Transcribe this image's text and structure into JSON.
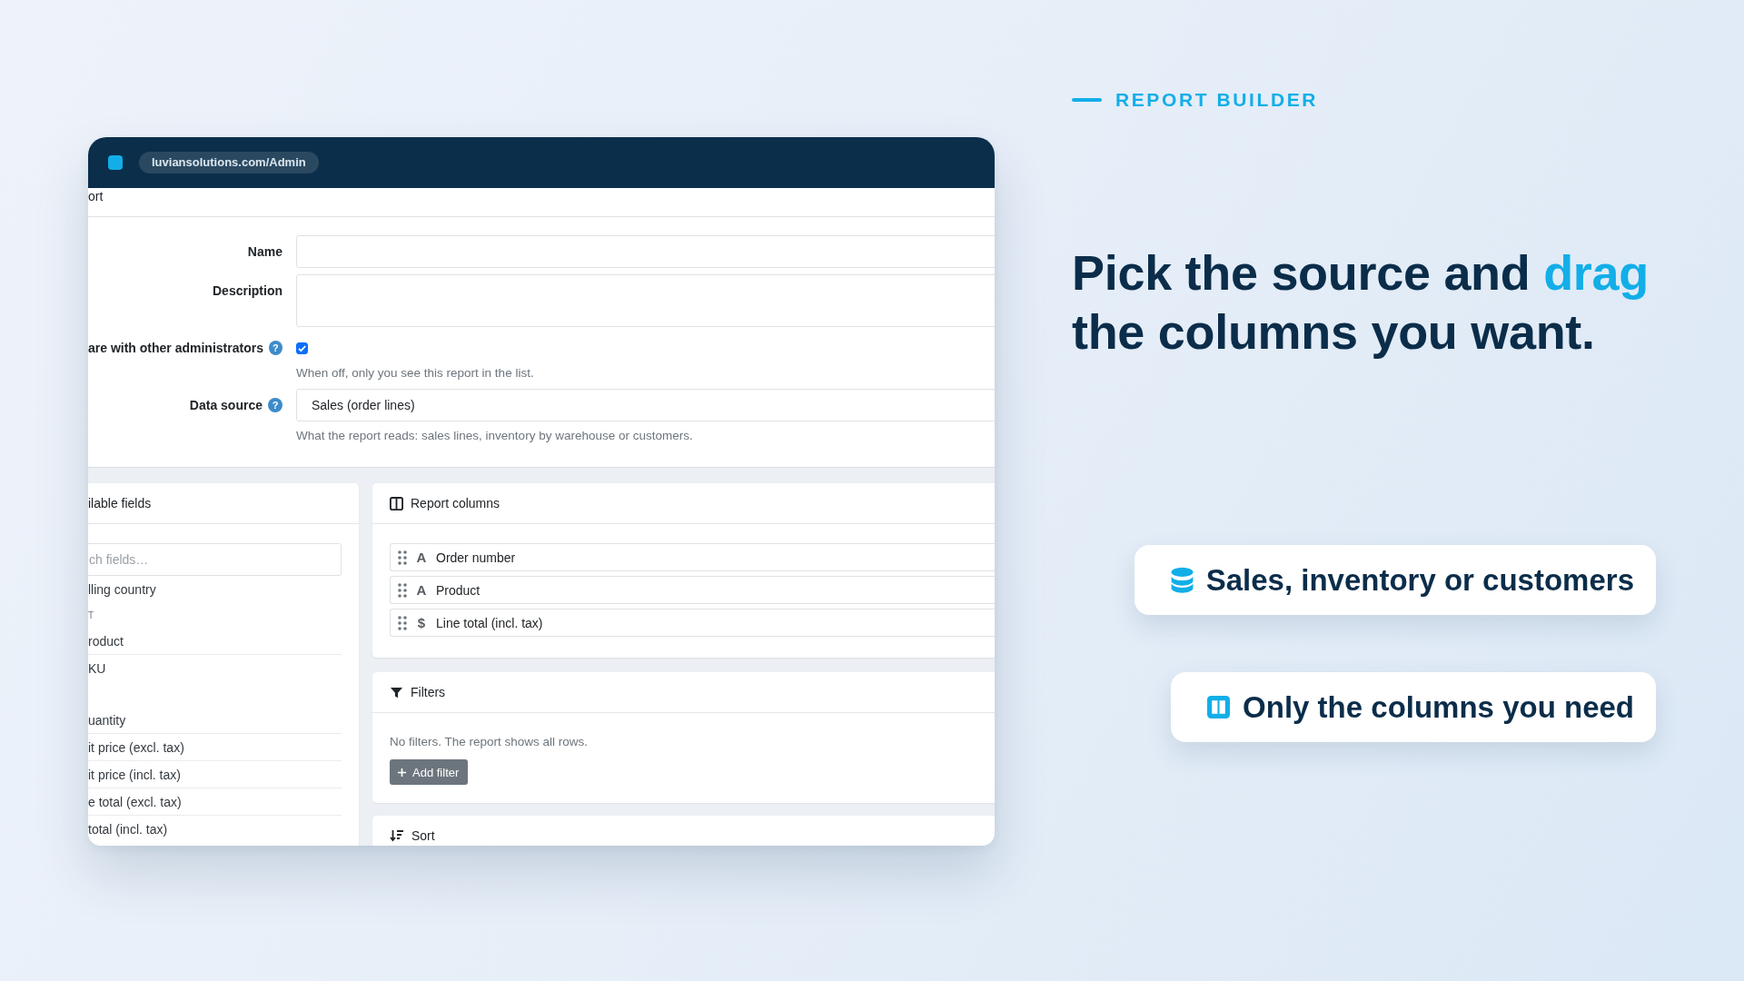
{
  "browser": {
    "url": "luviansolutions.com/Admin"
  },
  "page": {
    "breadcrumb": "ort",
    "form": {
      "name": {
        "label": "Name"
      },
      "description": {
        "label": "Description"
      },
      "share": {
        "label": "are with other administrators",
        "help": "?",
        "checked": true,
        "hint": "When off, only you see this report in the list."
      },
      "data_source": {
        "label": "Data source",
        "help": "?",
        "value": "Sales (order lines)",
        "hint": "What the report reads: sales lines, inventory by warehouse or customers."
      }
    },
    "available_fields": {
      "title": "ilable fields",
      "search": {
        "placeholder": "ch fields…"
      },
      "groups": [
        {
          "items": [
            "lling country"
          ]
        },
        {
          "heading": "T",
          "items": [
            "roduct",
            "KU"
          ]
        },
        {
          "items": [
            "uantity",
            "it price (excl. tax)",
            "it price (incl. tax)",
            "e total (excl. tax)",
            "total (incl. tax)"
          ]
        }
      ]
    },
    "report_columns": {
      "title": "Report columns",
      "columns": [
        {
          "type_symbol": "A",
          "label": "Order number"
        },
        {
          "type_symbol": "A",
          "label": "Product"
        },
        {
          "type_symbol": "$",
          "label": "Line total (incl. tax)"
        }
      ]
    },
    "filters": {
      "title": "Filters",
      "empty_text": "No filters. The report shows all rows.",
      "add_button": "Add filter"
    },
    "sort": {
      "title": "Sort"
    }
  },
  "eyebrow": "REPORT BUILDER",
  "headline": [
    {
      "text": "Pick the source and ",
      "highlight": false
    },
    {
      "text": "drag",
      "highlight": true
    },
    {
      "text": " the columns you want.",
      "highlight": false
    }
  ],
  "features": [
    {
      "kind": "database",
      "text": "Sales, inventory or customers"
    },
    {
      "kind": "columns",
      "text": "Only the columns you need"
    }
  ]
}
